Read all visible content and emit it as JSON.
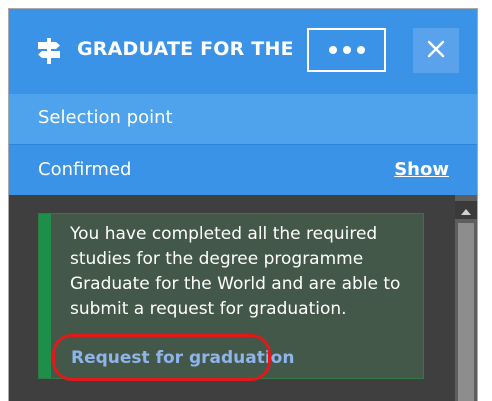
{
  "header": {
    "title": "GRADUATE FOR THE...",
    "icon": "signpost-icon",
    "more_icon": "more-dots-icon",
    "close_icon": "close-icon"
  },
  "rows": {
    "selection_label": "Selection point",
    "confirmed_label": "Confirmed",
    "show_label": "Show"
  },
  "notice": {
    "message": "You have completed all the required studies for the degree programme Graduate for the World and are able to submit a request for graduation.",
    "action_label": "Request for graduation"
  },
  "colors": {
    "header_blue": "#3b93e7",
    "selection_blue": "#4ea3ec",
    "panel_dark": "#3f3f3f",
    "success_green": "#1e8f4b",
    "link_blue": "#8fb4ea",
    "highlight_red": "#e01a1a"
  }
}
